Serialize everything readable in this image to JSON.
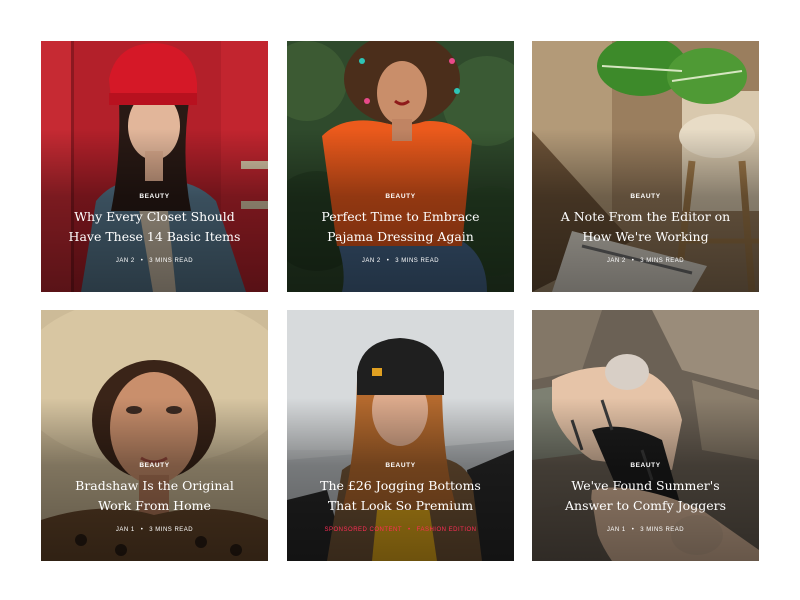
{
  "cards": [
    {
      "category": "Beauty",
      "title": "Why Every Closet Should Have These 14 Basic Items",
      "date": "Jan 2",
      "read_time": "3 Mins Read",
      "image_icon": "woman-red-beanie-denim-jacket-photo"
    },
    {
      "category": "Beauty",
      "title": "Perfect Time to Embrace Pajama Dressing Again",
      "date": "Jan 2",
      "read_time": "3 Mins Read",
      "image_icon": "woman-curly-hair-orange-blouse-photo"
    },
    {
      "category": "Beauty",
      "title": "A Note From the Editor on How We're Working",
      "date": "Jan 2",
      "read_time": "3 Mins Read",
      "image_icon": "plant-newspaper-stool-photo"
    },
    {
      "category": "Beauty",
      "title": "Bradshaw Is the Original Work From Home",
      "date": "Jan 1",
      "read_time": "3 Mins Read",
      "image_icon": "woman-straw-hat-photo"
    },
    {
      "category": "Beauty",
      "title": "The £26 Jogging Bottoms That Look So Premium",
      "date": "Sponsored Content",
      "read_time": "Fashion Edition",
      "image_icon": "woman-black-beanie-photo",
      "meta_color": "#ff2d55"
    },
    {
      "category": "Beauty",
      "title": "We've Found Summer's Answer to Comfy Joggers",
      "date": "Jan 1",
      "read_time": "3 Mins Read",
      "image_icon": "tattooed-women-on-rocks-photo"
    }
  ],
  "meta_separator": "•"
}
